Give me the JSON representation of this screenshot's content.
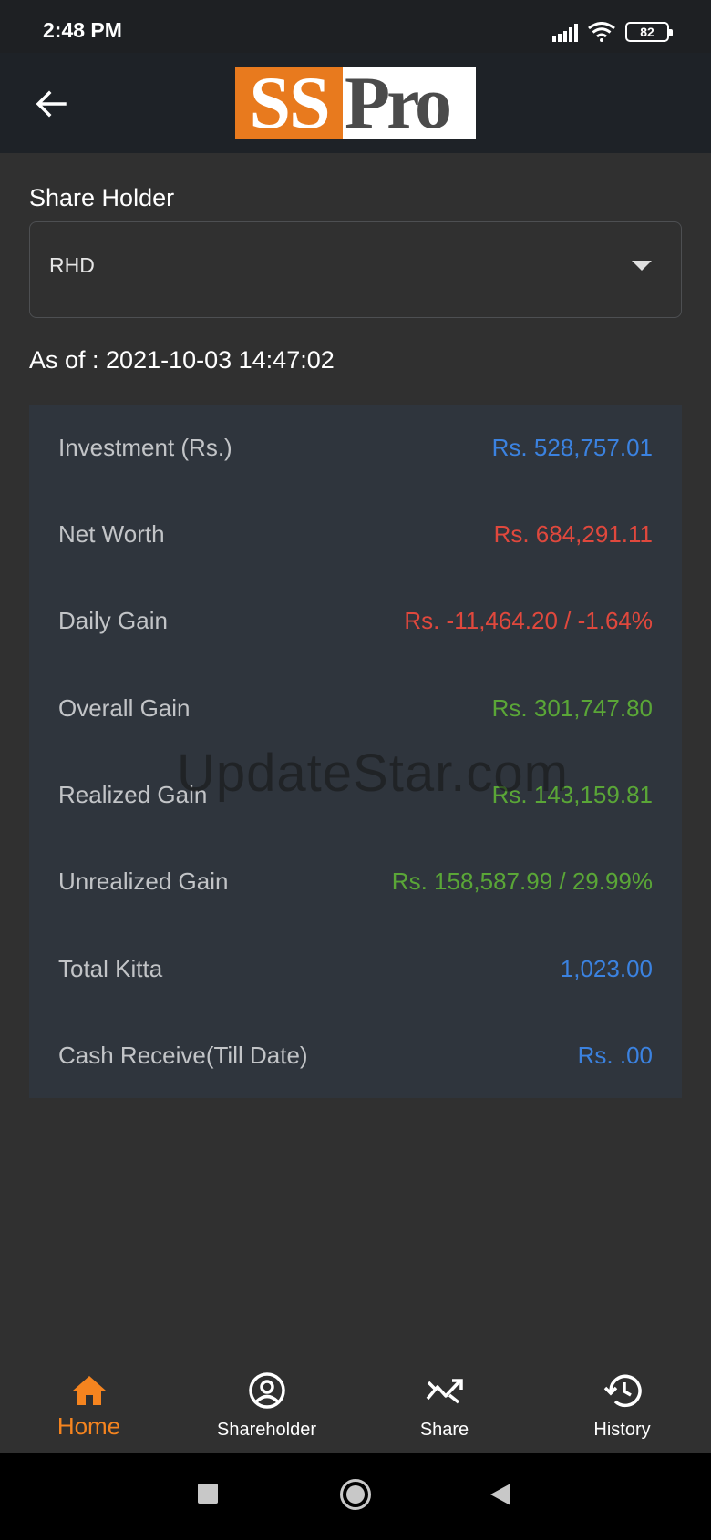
{
  "status_bar": {
    "time": "2:48 PM",
    "battery": "82"
  },
  "app_bar": {
    "logo_ss": "SS",
    "logo_pro": "Pro"
  },
  "shareholder": {
    "label": "Share Holder",
    "selected": "RHD"
  },
  "as_of": "As of : 2021-10-03 14:47:02",
  "summary": [
    {
      "label": "Investment (Rs.)",
      "value": "Rs. 528,757.01",
      "color": "#3b82e0"
    },
    {
      "label": "Net Worth",
      "value": "Rs. 684,291.11",
      "color": "#e0483d"
    },
    {
      "label": "Daily Gain",
      "value": "Rs. -11,464.20 / -1.64%",
      "color": "#e0483d"
    },
    {
      "label": "Overall Gain",
      "value": "Rs. 301,747.80",
      "color": "#5aa637"
    },
    {
      "label": "Realized Gain",
      "value": "Rs. 143,159.81",
      "color": "#5aa637"
    },
    {
      "label": "Unrealized Gain",
      "value": "Rs. 158,587.99 / 29.99%",
      "color": "#5aa637"
    },
    {
      "label": "Total Kitta",
      "value": "1,023.00",
      "color": "#3b82e0"
    },
    {
      "label": "Cash Receive(Till Date)",
      "value": "Rs. .00",
      "color": "#3b82e0"
    }
  ],
  "watermark": "UpdateStar.com",
  "bottom_nav": [
    {
      "label": "Home",
      "icon": "home-icon",
      "active": true
    },
    {
      "label": "Shareholder",
      "icon": "account-circle-icon",
      "active": false
    },
    {
      "label": "Share",
      "icon": "trending-icon",
      "active": false
    },
    {
      "label": "History",
      "icon": "history-icon",
      "active": false
    }
  ],
  "colors": {
    "accent": "#f5841f",
    "blue": "#3b82e0",
    "red": "#e0483d",
    "green": "#5aa637"
  }
}
